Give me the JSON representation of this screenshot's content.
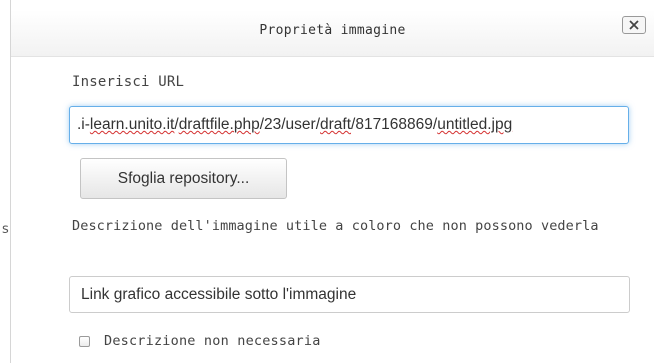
{
  "dialog": {
    "title": "Proprietà immagine",
    "close_label": "X"
  },
  "background": {
    "partial_text": "s"
  },
  "url": {
    "label": "Inserisci URL",
    "value_parts": [
      ".i-",
      "learn.unito.it",
      "/",
      "draftfile.php",
      "/23/user/",
      "draft",
      "/817168869/",
      "untitled.jpg"
    ]
  },
  "browse": {
    "label": "Sfoglia repository..."
  },
  "description": {
    "label": "Descrizione dell'immagine utile a coloro che non possono vederla",
    "value": "Link grafico accessibile sotto l'immagine"
  },
  "decorative": {
    "label": "Descrizione non necessaria",
    "checked": false
  },
  "colors": {
    "focus_border": "#66afe9",
    "spellcheck_underline": "#d43030"
  }
}
